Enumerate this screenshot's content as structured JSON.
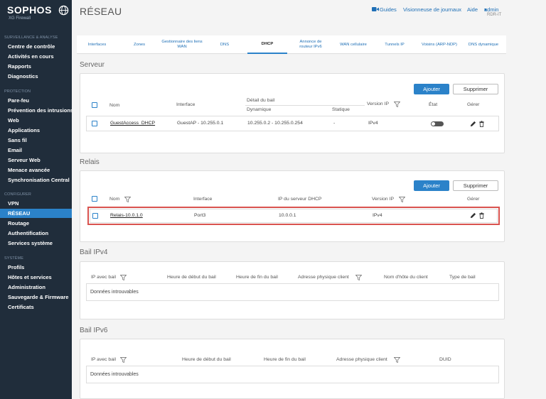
{
  "sidebar": {
    "brand": "SOPHOS",
    "product": "XG Firewall",
    "sections": [
      {
        "title": "SURVEILLANCE & ANALYSE",
        "items": [
          "Centre de contrôle",
          "Activités en cours",
          "Rapports",
          "Diagnostics"
        ]
      },
      {
        "title": "PROTECTION",
        "items": [
          "Pare-feu",
          "Prévention des intrusions",
          "Web",
          "Applications",
          "Sans fil",
          "Email",
          "Serveur Web",
          "Menace avancée",
          "Synchronisation Central"
        ]
      },
      {
        "title": "CONFIGURER",
        "items": [
          "VPN",
          "RÉSEAU",
          "Routage",
          "Authentification",
          "Services système"
        ]
      },
      {
        "title": "SYSTÈME",
        "items": [
          "Profils",
          "Hôtes et services",
          "Administration",
          "Sauvegarde & Firmware",
          "Certificats"
        ]
      }
    ],
    "active": "RÉSEAU"
  },
  "header": {
    "title": "RÉSEAU",
    "guides": "Guides",
    "log_viewer": "Visionneuse de journaux",
    "help": "Aide",
    "user": "admin",
    "device": "RDR-IT"
  },
  "tabs": [
    "Interfaces",
    "Zones",
    "Gestionnaire des liens WAN",
    "DNS",
    "DHCP",
    "Annonce de routeur IPv6",
    "WAN cellulaire",
    "Tunnels IP",
    "Voisins (ARP-NDP)",
    "DNS dynamique"
  ],
  "active_tab": "DHCP",
  "server": {
    "title": "Serveur",
    "add": "Ajouter",
    "delete": "Supprimer",
    "headers": {
      "name": "Nom",
      "interface": "Interface",
      "lease_detail": "Détail du bail",
      "dynamic": "Dynamique",
      "static": "Statique",
      "ip_version": "Version IP",
      "state": "État",
      "manage": "Gérer"
    },
    "rows": [
      {
        "name": "GuestAccess_DHCP",
        "interface": "GuestAP - 10.255.0.1",
        "dynamic": "10.255.0.2 - 10.255.0.254",
        "static": "-",
        "ip_version": "IPv4"
      }
    ]
  },
  "relay": {
    "title": "Relais",
    "add": "Ajouter",
    "delete": "Supprimer",
    "headers": {
      "name": "Nom",
      "interface": "Interface",
      "dhcp_ip": "IP du serveur DHCP",
      "ip_version": "Version IP",
      "manage": "Gérer"
    },
    "rows": [
      {
        "name": "Relais-10.0.1.0",
        "interface": "Port3",
        "dhcp_ip": "10.0.0.1",
        "ip_version": "IPv4"
      }
    ]
  },
  "lease_v4": {
    "title": "Bail IPv4",
    "headers": {
      "ip": "IP avec bail",
      "start": "Heure de début du bail",
      "end": "Heure de fin du bail",
      "mac": "Adresse physique client",
      "hostname": "Nom d'hôte du client",
      "type": "Type de bail"
    },
    "empty": "Données introuvables"
  },
  "lease_v6": {
    "title": "Bail IPv6",
    "headers": {
      "ip": "IP avec bail",
      "start": "Heure de début du bail",
      "end": "Heure de fin du bail",
      "mac": "Adresse physique client",
      "duid": "DUID"
    },
    "empty": "Données introuvables"
  },
  "colors": {
    "sidebar_bg": "#202d3b",
    "accent": "#2b82c9",
    "highlight": "#d9534f"
  }
}
